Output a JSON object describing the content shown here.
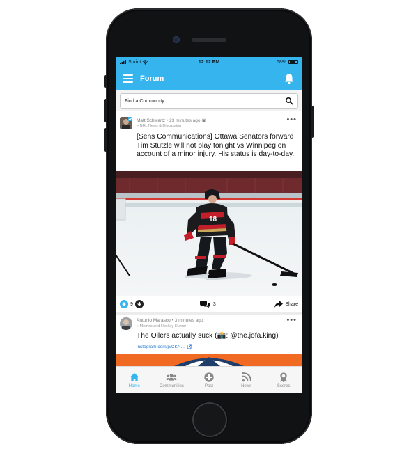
{
  "status_bar": {
    "carrier": "Sprint",
    "time": "12:12 PM",
    "battery": "68%"
  },
  "header": {
    "title": "Forum"
  },
  "search": {
    "placeholder": "Find a Community"
  },
  "feed": [
    {
      "author": "Matt Schwartz",
      "time": "23 minutes ago",
      "community": "NHL News & Discussion",
      "title": "[Sens Communications] Ottawa Senators forward Tim Stützle will not play tonight vs Winnipeg on account of a minor injury. His status is day-to-day.",
      "upvotes": "9",
      "comments": "3",
      "share_label": "Share"
    },
    {
      "author": "Antonio Marasco",
      "time": "3 minutes ago",
      "community": "Memes and Hockey Humor",
      "title": "The Oilers actually suck (📸: @the.jofa.king)",
      "link": "instagram.com/p/CKN..."
    }
  ],
  "tabs": [
    {
      "label": "Home",
      "icon": "home-icon"
    },
    {
      "label": "Communities",
      "icon": "communities-icon"
    },
    {
      "label": "Post",
      "icon": "post-icon"
    },
    {
      "label": "News",
      "icon": "news-icon"
    },
    {
      "label": "Scores",
      "icon": "scores-icon"
    }
  ],
  "colors": {
    "accent": "#36b4ee",
    "link": "#2d7ed2"
  }
}
